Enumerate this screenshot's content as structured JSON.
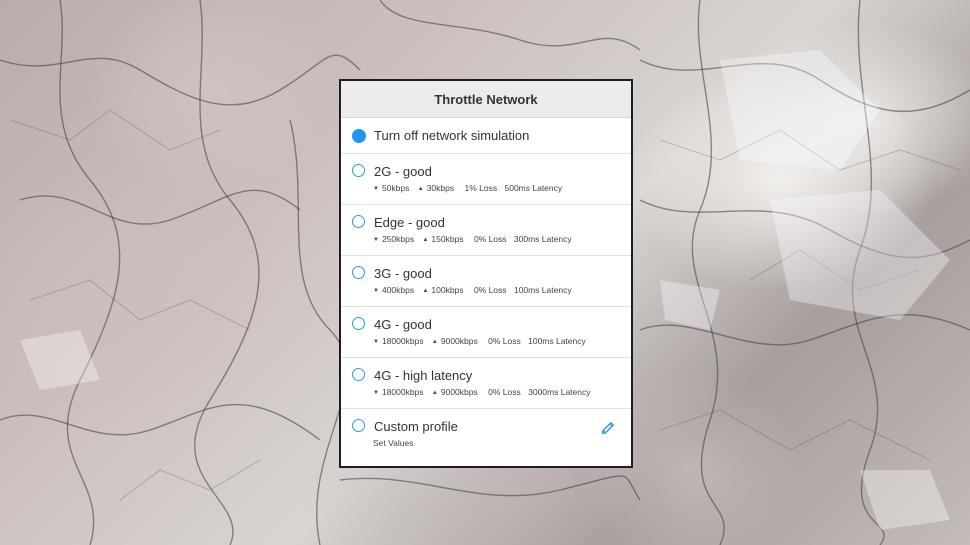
{
  "dialog": {
    "title": "Throttle Network",
    "selected_index": 0,
    "accent_color": "#2196f3",
    "items": [
      {
        "label": "Turn off network simulation"
      },
      {
        "label": "2G - good",
        "down": "50kbps",
        "up": "30kbps",
        "loss": "1% Loss",
        "latency": "500ms Latency"
      },
      {
        "label": "Edge - good",
        "down": "250kbps",
        "up": "150kbps",
        "loss": "0% Loss",
        "latency": "300ms Latency"
      },
      {
        "label": "3G - good",
        "down": "400kbps",
        "up": "100kbps",
        "loss": "0% Loss",
        "latency": "100ms Latency"
      },
      {
        "label": "4G - good",
        "down": "18000kbps",
        "up": "9000kbps",
        "loss": "0% Loss",
        "latency": "100ms Latency"
      },
      {
        "label": "4G - high latency",
        "down": "18000kbps",
        "up": "9000kbps",
        "loss": "0% Loss",
        "latency": "3000ms Latency"
      },
      {
        "label": "Custom profile",
        "sublabel": "Set Values",
        "edit_icon": "pencil-icon"
      }
    ]
  }
}
